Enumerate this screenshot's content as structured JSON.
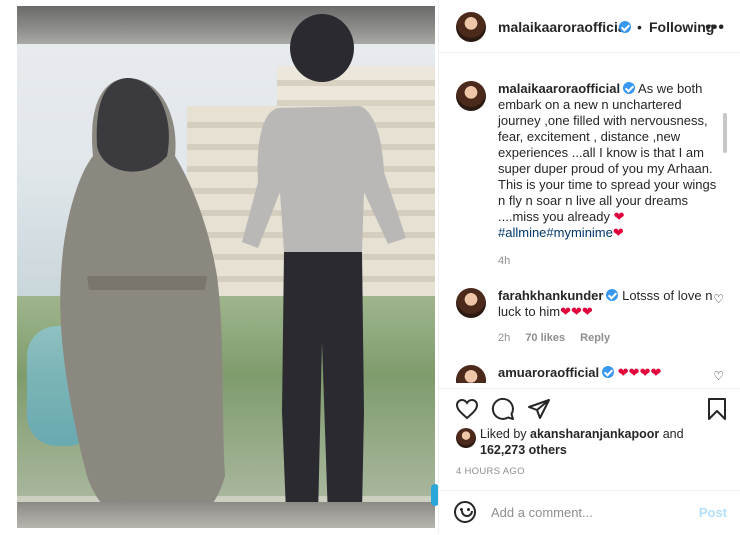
{
  "post": {
    "author": "malaikaaroraofficial",
    "follow_sep": "•",
    "follow_label": "Following",
    "more_label": "•••",
    "caption_text": " As we both embark on a new n unchartered journey ,one filled with nervousness, fear, excitement , distance ,new experiences ...all I know is that I am super duper proud of you my Arhaan. This is your time to spread your wings n fly n soar n live all your dreams ....miss you already ",
    "caption_heart": "❤",
    "hashtags": "#allmine#myminime",
    "hashtag_heart": "❤",
    "caption_time": "4h"
  },
  "comments": [
    {
      "user": "farahkhankunder",
      "text": " Lotsss of love n luck to him",
      "hearts": "❤❤❤",
      "time": "2h",
      "likes": "70 likes",
      "reply": "Reply"
    },
    {
      "user": "amuaroraofficial",
      "text": " ",
      "hearts": "❤❤❤❤"
    }
  ],
  "likes": {
    "prefix": "Liked by ",
    "user": "akansharanjankapoor",
    "and": " and",
    "count": "162,273 others"
  },
  "timestamp": "4 HOURS AGO",
  "comment_box": {
    "placeholder": "Add a comment...",
    "post_label": "Post"
  },
  "colors": {
    "verified": "#3897f0",
    "heart": "#e0003a",
    "hashtag": "#00376b",
    "post_disabled": "#b2dffc"
  }
}
